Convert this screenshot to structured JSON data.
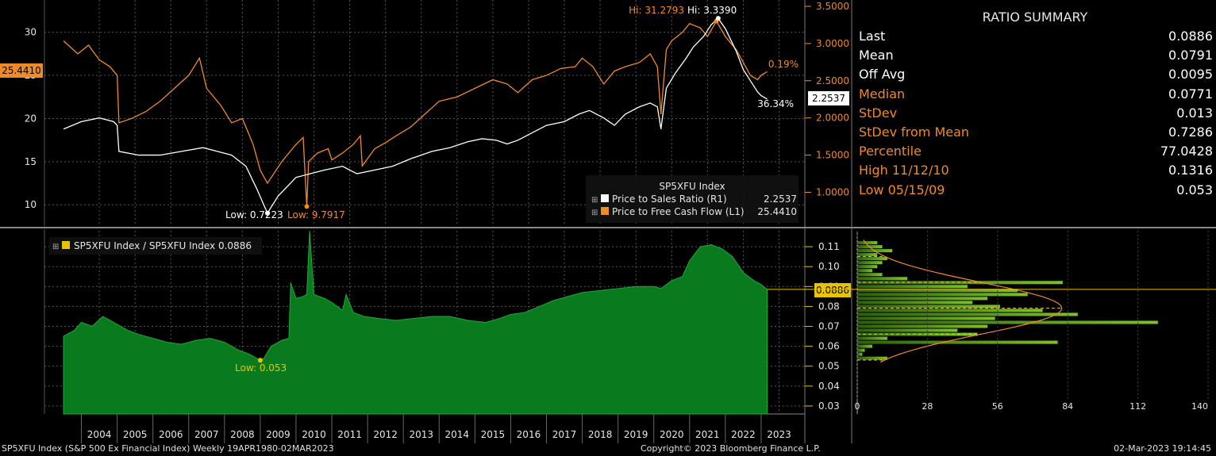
{
  "summary": {
    "title": "RATIO SUMMARY",
    "rows": [
      {
        "label": "Last",
        "value": "0.0886",
        "color": "#ffffff"
      },
      {
        "label": "Mean",
        "value": "0.0791",
        "color": "#ffffff"
      },
      {
        "label": "Off Avg",
        "value": "0.0095",
        "color": "#ffffff"
      },
      {
        "label": "Median",
        "value": "0.0771",
        "color": "#f08a24"
      },
      {
        "label": "StDev",
        "value": "0.013",
        "color": "#f08a24"
      },
      {
        "label": "StDev from Mean",
        "value": "0.7286",
        "color": "#f08a24"
      },
      {
        "label": "Percentile",
        "value": "77.0428",
        "color": "#f08a24"
      },
      {
        "label": "High 11/12/10",
        "value": "0.1316",
        "color": "#f08a24"
      },
      {
        "label": "Low 05/15/09",
        "value": "0.053",
        "color": "#f08a24"
      }
    ]
  },
  "footer": {
    "left": "SP5XFU Index (S&P 500 Ex Financial Index)  Weekly 19APR1980-02MAR2023",
    "center": "Copyright© 2023 Bloomberg Finance L.P.",
    "right": "02-Mar-2023 19:14:45"
  },
  "colors": {
    "orange": "#f08a24",
    "white": "#ffffff",
    "green": "#0a7a1e",
    "yellow": "#e8c400",
    "background": "#000000"
  },
  "chart_data": [
    {
      "type": "line",
      "x_axis": {
        "labels": [
          "2004",
          "2005",
          "2006",
          "2007",
          "2008",
          "2009",
          "2010",
          "2011",
          "2012",
          "2013",
          "2014",
          "2015",
          "2016",
          "2017",
          "2018",
          "2019",
          "2020",
          "2021",
          "2022",
          "2023"
        ],
        "range": [
          2003.5,
          2024.0
        ]
      },
      "left_axis": {
        "ticks": [
          "10",
          "15",
          "20",
          "25",
          "30"
        ],
        "range": [
          8.0,
          33.0
        ]
      },
      "right_axis": {
        "ticks": [
          "1.0000",
          "1.5000",
          "2.0000",
          "2.5000",
          "3.0000",
          "3.5000"
        ],
        "range": [
          0.6,
          3.5
        ]
      },
      "legend": {
        "title": "SP5XFU Index",
        "placement": "bottom-right",
        "entries": [
          {
            "name": "Price to Sales Ratio  (R1)",
            "last": "2.2537",
            "color": "#ffffff"
          },
          {
            "name": "Price to Free Cash Flow  (L1)",
            "last": "25.4410",
            "color": "#f08a24"
          }
        ]
      },
      "annotations": {
        "left_last": "25.4410",
        "right_last": "2.2537",
        "pct_orange": "0.19%",
        "pct_white": "36.34%",
        "hi_orange": "Hi: 31.2793",
        "hi_white": "Hi: 3.3390",
        "low_white": "Low: 0.7223",
        "low_orange": "Low: 9.7917"
      },
      "series": [
        {
          "name": "Price to Free Cash Flow  (L1)",
          "axis": "left",
          "color": "#f08a24",
          "x": [
            2003.5,
            2003.9,
            2004.2,
            2004.5,
            2004.8,
            2005.0,
            2005.05,
            2005.4,
            2005.8,
            2006.2,
            2006.6,
            2007.0,
            2007.3,
            2007.5,
            2007.9,
            2008.2,
            2008.5,
            2008.8,
            2009.0,
            2009.2,
            2009.6,
            2010.0,
            2010.2,
            2010.3,
            2010.35,
            2010.6,
            2010.9,
            2011.0,
            2011.3,
            2011.6,
            2011.8,
            2011.85,
            2012.2,
            2012.5,
            2012.8,
            2013.2,
            2013.6,
            2014.0,
            2014.5,
            2015.0,
            2015.5,
            2015.9,
            2016.2,
            2016.6,
            2017.0,
            2017.4,
            2017.8,
            2018.0,
            2018.3,
            2018.6,
            2018.9,
            2019.2,
            2019.6,
            2019.9,
            2020.1,
            2020.2,
            2020.35,
            2020.5,
            2020.8,
            2021.0,
            2021.3,
            2021.5,
            2021.75,
            2022.0,
            2022.3,
            2022.5,
            2022.7,
            2022.9,
            2023.0,
            2023.17
          ],
          "y": [
            29.0,
            27.5,
            28.5,
            26.8,
            26.0,
            25.0,
            19.5,
            20.0,
            20.8,
            22.0,
            23.5,
            25.0,
            27.0,
            23.5,
            21.5,
            19.5,
            20.0,
            17.0,
            14.0,
            12.5,
            15.0,
            17.0,
            17.8,
            9.8,
            15.0,
            16.0,
            16.5,
            15.2,
            16.0,
            17.0,
            18.0,
            14.5,
            16.5,
            17.2,
            18.0,
            19.0,
            20.5,
            22.0,
            22.5,
            23.5,
            24.5,
            24.0,
            23.0,
            24.5,
            25.0,
            25.8,
            26.0,
            27.0,
            26.0,
            24.0,
            25.5,
            26.0,
            26.5,
            27.5,
            26.0,
            20.5,
            28.0,
            29.0,
            30.0,
            31.0,
            30.5,
            29.5,
            31.3,
            29.5,
            28.0,
            26.5,
            25.0,
            24.5,
            25.0,
            25.44
          ]
        },
        {
          "name": "Price to Sales Ratio  (R1)",
          "axis": "right",
          "color": "#ffffff",
          "x": [
            2003.5,
            2004.0,
            2004.5,
            2004.9,
            2005.0,
            2005.05,
            2005.6,
            2006.2,
            2006.8,
            2007.4,
            2007.8,
            2008.2,
            2008.6,
            2008.9,
            2009.2,
            2009.5,
            2010.0,
            2010.4,
            2010.8,
            2011.3,
            2011.7,
            2012.2,
            2012.7,
            2013.2,
            2013.8,
            2014.3,
            2014.8,
            2015.2,
            2015.6,
            2015.9,
            2016.2,
            2016.6,
            2017.0,
            2017.5,
            2017.9,
            2018.2,
            2018.6,
            2018.9,
            2019.2,
            2019.6,
            2019.9,
            2020.1,
            2020.2,
            2020.35,
            2020.6,
            2020.9,
            2021.1,
            2021.4,
            2021.6,
            2021.8,
            2022.0,
            2022.3,
            2022.5,
            2022.7,
            2022.9,
            2023.0,
            2023.17
          ],
          "y": [
            1.85,
            1.95,
            2.0,
            1.95,
            1.9,
            1.55,
            1.5,
            1.5,
            1.55,
            1.6,
            1.55,
            1.5,
            1.35,
            1.05,
            0.72,
            0.95,
            1.2,
            1.25,
            1.3,
            1.35,
            1.25,
            1.3,
            1.35,
            1.45,
            1.55,
            1.6,
            1.68,
            1.72,
            1.7,
            1.65,
            1.7,
            1.8,
            1.9,
            1.95,
            2.05,
            2.1,
            2.0,
            1.9,
            2.05,
            2.15,
            2.2,
            2.15,
            1.85,
            2.4,
            2.6,
            2.8,
            2.95,
            3.1,
            3.25,
            3.339,
            3.2,
            2.9,
            2.65,
            2.5,
            2.35,
            2.3,
            2.2537
          ]
        }
      ]
    },
    {
      "type": "area",
      "legend": {
        "entries": [
          {
            "name": "SP5XFU Index / SP5XFU Index 0.0886",
            "color": "#e8c400"
          }
        ],
        "placement": "top-left"
      },
      "y_axis": {
        "ticks": [
          "0.03",
          "0.04",
          "0.05",
          "0.06",
          "0.07",
          "0.08",
          "0.09",
          "0.10",
          "0.11"
        ],
        "range": [
          0.026,
          0.118
        ]
      },
      "annotations": {
        "last": "0.0886",
        "low": "Low: 0.053"
      },
      "series": [
        {
          "name": "SP5XFU Index / SP5XFU Index",
          "color": "#0a7a1e",
          "x": [
            2003.5,
            2003.8,
            2004.0,
            2004.3,
            2004.6,
            2004.8,
            2005.0,
            2005.3,
            2005.6,
            2006.0,
            2006.4,
            2006.8,
            2007.2,
            2007.6,
            2008.0,
            2008.4,
            2008.7,
            2009.0,
            2009.1,
            2009.3,
            2009.6,
            2009.8,
            2009.85,
            2010.0,
            2010.2,
            2010.3,
            2010.38,
            2010.5,
            2010.8,
            2011.0,
            2011.3,
            2011.4,
            2011.6,
            2011.9,
            2012.3,
            2012.8,
            2013.3,
            2013.8,
            2014.3,
            2014.8,
            2015.3,
            2015.7,
            2016.0,
            2016.4,
            2016.8,
            2017.2,
            2017.6,
            2018.0,
            2018.5,
            2019.0,
            2019.5,
            2020.0,
            2020.2,
            2020.5,
            2020.8,
            2021.0,
            2021.3,
            2021.6,
            2021.9,
            2022.2,
            2022.5,
            2022.8,
            2023.0,
            2023.17
          ],
          "y": [
            0.065,
            0.068,
            0.072,
            0.07,
            0.075,
            0.073,
            0.071,
            0.068,
            0.066,
            0.064,
            0.062,
            0.061,
            0.063,
            0.064,
            0.062,
            0.058,
            0.056,
            0.053,
            0.054,
            0.06,
            0.063,
            0.064,
            0.092,
            0.084,
            0.085,
            0.086,
            0.118,
            0.086,
            0.084,
            0.082,
            0.078,
            0.086,
            0.077,
            0.075,
            0.074,
            0.073,
            0.074,
            0.075,
            0.075,
            0.073,
            0.072,
            0.074,
            0.076,
            0.077,
            0.08,
            0.083,
            0.085,
            0.087,
            0.088,
            0.089,
            0.09,
            0.09,
            0.089,
            0.093,
            0.095,
            0.103,
            0.11,
            0.111,
            0.109,
            0.105,
            0.097,
            0.093,
            0.091,
            0.0886
          ]
        }
      ]
    },
    {
      "type": "bar",
      "orientation": "horizontal",
      "x_axis": {
        "ticks": [
          "0",
          "28",
          "56",
          "84",
          "112",
          "140"
        ],
        "range": [
          0,
          140
        ]
      },
      "y_axis_range": [
        0.026,
        0.118
      ],
      "bins_center": [
        0.054,
        0.056,
        0.058,
        0.06,
        0.062,
        0.064,
        0.066,
        0.068,
        0.07,
        0.072,
        0.074,
        0.076,
        0.078,
        0.08,
        0.082,
        0.084,
        0.086,
        0.088,
        0.09,
        0.092,
        0.094,
        0.096,
        0.098,
        0.1,
        0.102,
        0.104,
        0.106,
        0.108,
        0.11,
        0.112
      ],
      "values": [
        12,
        2,
        3,
        6,
        80,
        12,
        48,
        40,
        52,
        120,
        55,
        88,
        74,
        57,
        46,
        52,
        68,
        64,
        44,
        82,
        20,
        10,
        6,
        8,
        10,
        12,
        8,
        14,
        10,
        8
      ]
    }
  ]
}
